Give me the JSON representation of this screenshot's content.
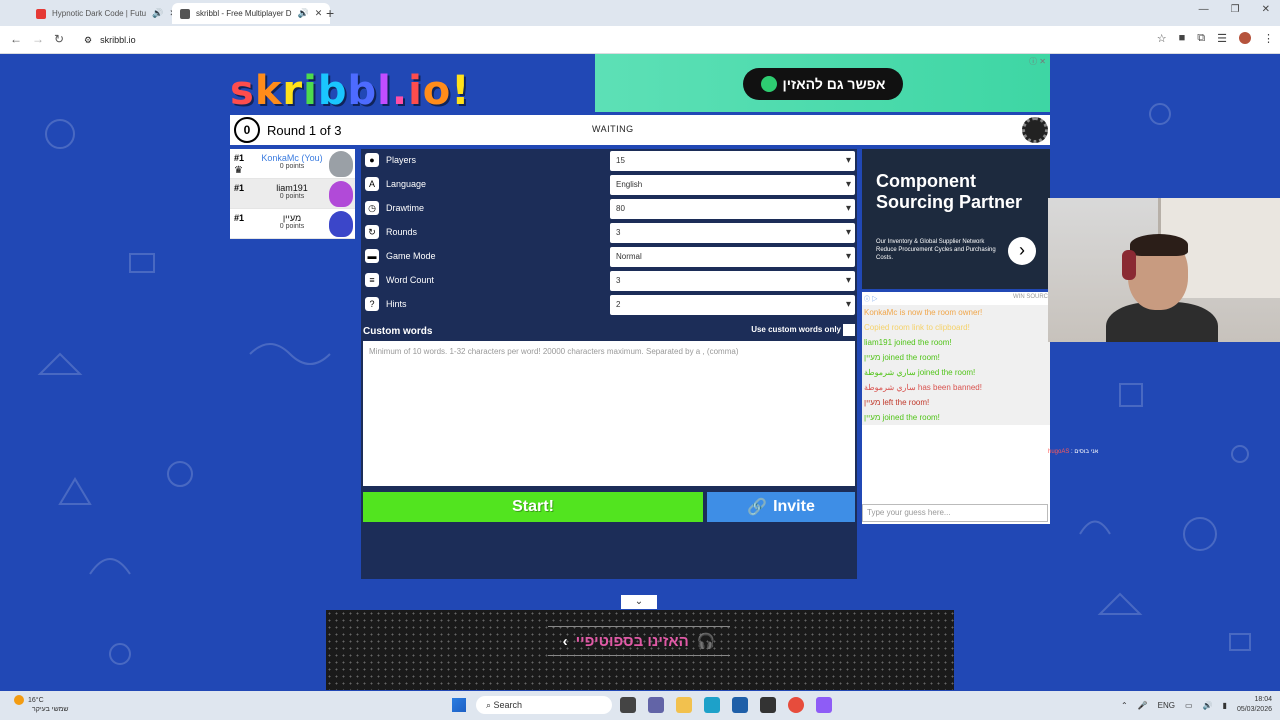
{
  "browser": {
    "tabs": [
      {
        "title": "Hypnotic Dark Code | Futu",
        "active": false
      },
      {
        "title": "skribbl - Free Multiplayer D",
        "active": true
      }
    ],
    "url": "skribbl.io"
  },
  "ads": {
    "top_pill": "אפשר גם להאזין",
    "side_heading": "Component Sourcing Partner",
    "side_sub": "Our Inventory & Global Supplier Network Reduce Procurement Cycles and Purchasing Costs.",
    "bottom": "האזינו בספוטיפיי"
  },
  "game": {
    "logo": "skribbl.io",
    "timer": "0",
    "round": "Round 1 of 3",
    "status": "WAITING"
  },
  "players": [
    {
      "rank": "#1",
      "name": "KonkaMc (You)",
      "points": "0 points",
      "you": true,
      "color": "#9aa0a6"
    },
    {
      "rank": "#1",
      "name": "liam191",
      "points": "0 points",
      "you": false,
      "color": "#b14ad8"
    },
    {
      "rank": "#1",
      "name": "מעיין",
      "points": "0 points",
      "you": false,
      "color": "#3b46c9"
    }
  ],
  "settings": {
    "rows": [
      {
        "label": "Players",
        "value": "15",
        "icon": "person-icon"
      },
      {
        "label": "Language",
        "value": "English",
        "icon": "language-icon"
      },
      {
        "label": "Drawtime",
        "value": "80",
        "icon": "timer-icon"
      },
      {
        "label": "Rounds",
        "value": "3",
        "icon": "rounds-icon"
      },
      {
        "label": "Game Mode",
        "value": "Normal",
        "icon": "gamemode-icon"
      },
      {
        "label": "Word Count",
        "value": "3",
        "icon": "wordcount-icon"
      },
      {
        "label": "Hints",
        "value": "2",
        "icon": "hint-icon"
      }
    ],
    "custom_words_title": "Custom words",
    "custom_only_label": "Use custom words only",
    "custom_placeholder": "Minimum of 10 words. 1-32 characters per word! 20000 characters maximum. Separated by a , (comma)",
    "start_label": "Start!",
    "invite_label": "Invite"
  },
  "chat": {
    "top_right": "WIN SOURC",
    "messages": [
      {
        "text": "KonkaMc is now the room owner!",
        "color": "#f0a64a"
      },
      {
        "text": "Copied room link to clipboard!",
        "color": "#f5d26a"
      },
      {
        "text": "liam191 joined the room!",
        "color": "#52c41a"
      },
      {
        "text": "מעיין joined the room!",
        "color": "#52c41a"
      },
      {
        "text": "ساري شرموطة joined the room!",
        "color": "#52c41a"
      },
      {
        "text": "ساري شرموطة has been banned!",
        "color": "#d9534f"
      },
      {
        "text": "מעיין left the room!",
        "color": "#c0392b"
      },
      {
        "text": "מעיין joined the room!",
        "color": "#52c41a"
      }
    ],
    "guess_placeholder": "Type your guess here..."
  },
  "stream_overlay": {
    "name": "hugoAS",
    "message": ": אני בוסים"
  },
  "taskbar": {
    "weather_temp": "16°C",
    "weather_desc": "שמשי בעיקר",
    "search": "Search",
    "lang": "ENG",
    "time": "18:04",
    "date": "05/03/2026"
  }
}
